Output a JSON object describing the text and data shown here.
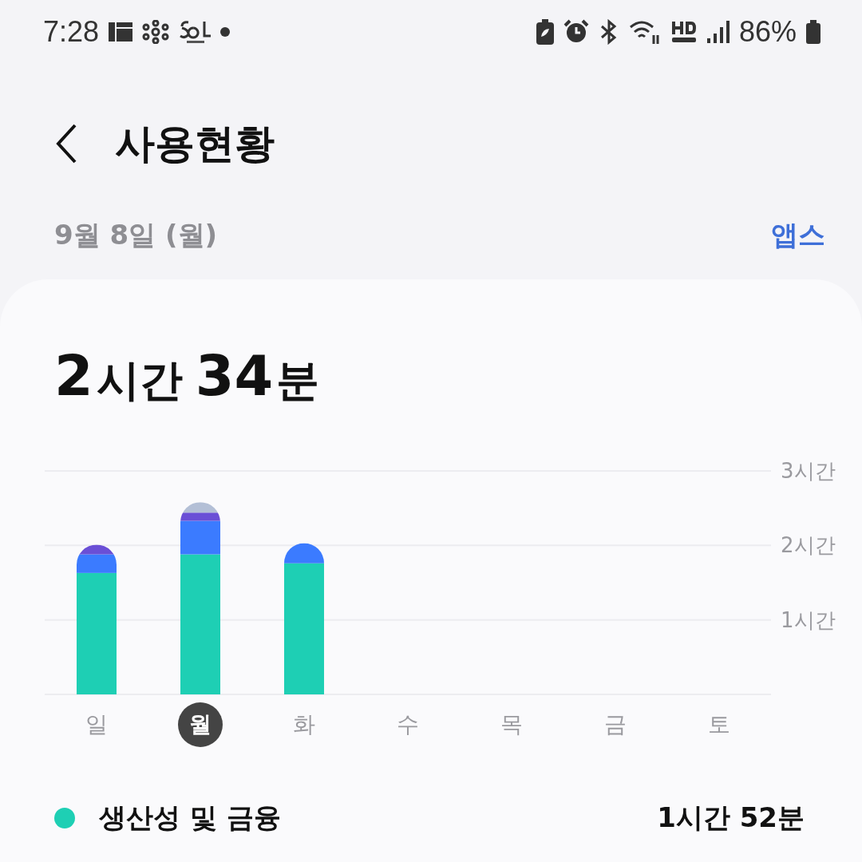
{
  "status_bar": {
    "time": "7:28",
    "battery": "86%"
  },
  "header": {
    "title": "사용현황"
  },
  "date_row": {
    "date": "9월 8일 (월)",
    "link": "앱스"
  },
  "summary": {
    "hours": "2",
    "hours_unit": "시간",
    "minutes": "34",
    "minutes_unit": "분"
  },
  "chart": {
    "chart_data": {
      "type": "bar",
      "stacked": true,
      "categories": [
        "일",
        "월",
        "화",
        "수",
        "목",
        "금",
        "토"
      ],
      "ylim": [
        0,
        3
      ],
      "yticks": [
        {
          "value": 1,
          "label": "1시간"
        },
        {
          "value": 2,
          "label": "2시간"
        },
        {
          "value": 3,
          "label": "3시간"
        }
      ],
      "series": [
        {
          "name": "생산성 및 금융",
          "color": "#1ecfb4",
          "values": [
            1.63,
            1.88,
            1.76,
            null,
            null,
            null,
            null
          ]
        },
        {
          "color": "#3b7bff",
          "values": [
            0.25,
            0.45,
            0.27,
            null,
            null,
            null,
            null
          ]
        },
        {
          "color": "#6a4fd6",
          "values": [
            0.13,
            0.11,
            0,
            null,
            null,
            null,
            null
          ]
        },
        {
          "color": "#b3bfd6",
          "values": [
            0,
            0.14,
            0,
            null,
            null,
            null,
            null
          ]
        }
      ]
    },
    "days": [
      {
        "selected": false
      },
      {
        "selected": true
      },
      {
        "selected": false
      },
      {
        "selected": false
      },
      {
        "selected": false
      },
      {
        "selected": false
      },
      {
        "selected": false
      }
    ]
  },
  "legend": [
    {
      "time": "1시간 52분"
    }
  ]
}
